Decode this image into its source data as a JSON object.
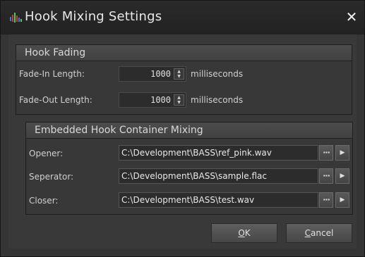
{
  "window": {
    "title": "Hook Mixing Settings",
    "close_glyph": "✕",
    "app_icon": "waveform-app-icon"
  },
  "fading": {
    "title": "Hook Fading",
    "fade_in": {
      "label": "Fade-In Length:",
      "value": "1000",
      "unit": "milliseconds"
    },
    "fade_out": {
      "label": "Fade-Out Length:",
      "value": "1000",
      "unit": "milliseconds"
    }
  },
  "mixing": {
    "title": "Embedded Hook Container Mixing",
    "rows": [
      {
        "label": "Opener:",
        "path": "C:\\Development\\BASS\\ref_pink.wav"
      },
      {
        "label": "Seperator:",
        "path": "C:\\Development\\BASS\\sample.flac"
      },
      {
        "label": "Closer:",
        "path": "C:\\Development\\BASS\\test.wav"
      }
    ],
    "browse_glyph": "···",
    "play_glyph": "▶"
  },
  "buttons": {
    "ok": {
      "accel": "O",
      "rest": "K"
    },
    "cancel": {
      "accel": "C",
      "rest": "ancel"
    }
  },
  "spin_glyphs": {
    "up": "▲",
    "down": "▼"
  }
}
